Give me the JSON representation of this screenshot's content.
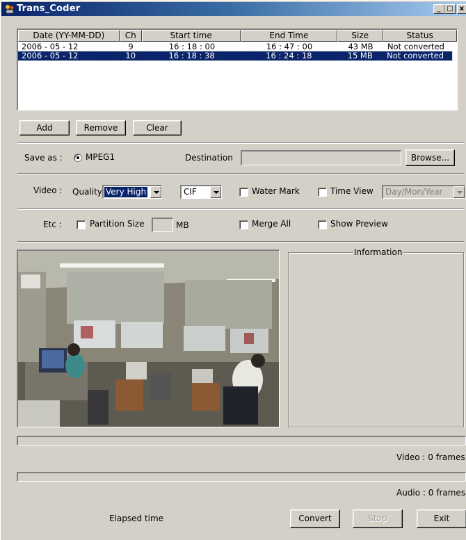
{
  "window": {
    "title": "Trans_Coder",
    "minimize": "_",
    "maximize": "□",
    "close": "x"
  },
  "list": {
    "columns": [
      "Date (YY-MM-DD)",
      "Ch",
      "Start time",
      "End Time",
      "Size",
      "Status"
    ],
    "rows": [
      {
        "date": "2006 - 05 - 12",
        "ch": "9",
        "start": "16 : 18 : 00",
        "end": "16 : 47 : 00",
        "size": "43 MB",
        "status": "Not converted",
        "selected": false
      },
      {
        "date": "2006 - 05 - 12",
        "ch": "10",
        "start": "16 : 18 : 38",
        "end": "16 : 24 : 18",
        "size": "15 MB",
        "status": "Not converted",
        "selected": true
      }
    ]
  },
  "buttons": {
    "add": "Add",
    "remove": "Remove",
    "clear": "Clear",
    "browse": "Browse...",
    "convert": "Convert",
    "stop": "Stop",
    "exit": "Exit"
  },
  "save": {
    "label": "Save as :",
    "format": "MPEG1",
    "destination_label": "Destination",
    "destination_value": ""
  },
  "video": {
    "label": "Video :",
    "quality_label": "Quality",
    "quality_value": "Very High",
    "size_value": "CIF",
    "watermark_label": "Water Mark",
    "timeview_label": "Time View",
    "date_format": "Day/Mon/Year"
  },
  "etc": {
    "label": "Etc :",
    "partition_label": "Partition Size",
    "partition_value": "",
    "unit": "MB",
    "merge_label": "Merge All",
    "preview_label": "Show Preview"
  },
  "information": {
    "title": "Information"
  },
  "status": {
    "video_frames": "Video : 0 frames",
    "audio_frames": "Audio : 0 frames",
    "elapsed_label": "Elapsed time"
  },
  "colors": {
    "face": "#d4d0c8",
    "selection": "#0a246a",
    "title_start": "#0a246a",
    "title_end": "#a6caf0"
  },
  "icons": [
    "app-icon",
    "minimize-icon",
    "maximize-icon",
    "close-icon",
    "radio-icon",
    "checkbox-icon",
    "dropdown-arrow-icon"
  ]
}
